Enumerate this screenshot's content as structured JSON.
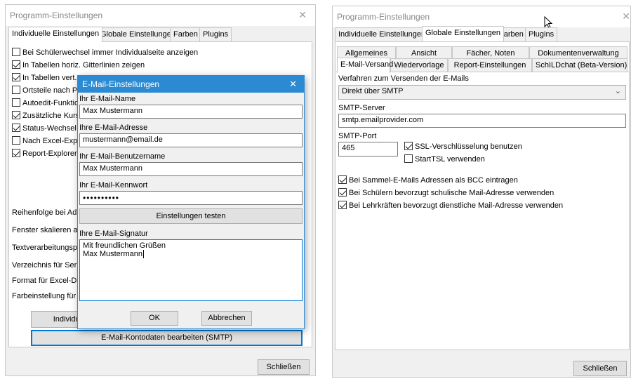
{
  "left_window": {
    "title": "Programm-Einstellungen",
    "close_glyph": "✕",
    "tabs": [
      "Individuelle Einstellungen",
      "Globale Einstellungen",
      "Farben",
      "Plugins"
    ],
    "checkboxes": [
      {
        "label": "Bei Schülerwechsel immer Individualseite anzeigen",
        "checked": false
      },
      {
        "label": "In Tabellen horiz. Gitterlinien zeigen",
        "checked": true
      },
      {
        "label": "In Tabellen vert.",
        "checked": true
      },
      {
        "label": "Ortsteile nach PLZ",
        "checked": false
      },
      {
        "label": "Autoedit-Funktion",
        "checked": false
      },
      {
        "label": "Zusätzliche Kursle",
        "checked": true
      },
      {
        "label": "Status-Wechsel o",
        "checked": true
      },
      {
        "label": "Nach Excel-Expor",
        "checked": false
      },
      {
        "label": "Report-Explorer a",
        "checked": true
      }
    ],
    "labels": [
      "Reihenfolge bei Adre",
      "Fenster skalieren au",
      "Textverarbeitungspr",
      "Verzeichnis für Serie",
      "Format für Excel-Dat",
      "Farbeinstellung für S"
    ],
    "individual_button": "Individuel",
    "smtp_button": "E-Mail-Kontodaten bearbeiten (SMTP)",
    "close_button": "Schließen"
  },
  "dialog": {
    "title": "E-Mail-Einstellungen",
    "close_glyph": "✕",
    "name_label": "Ihr E-Mail-Name",
    "name_value": "Max Mustermann",
    "address_label": "Ihre E-Mail-Adresse",
    "address_value": "mustermann@email.de",
    "username_label": "Ihr E-Mail-Benutzername",
    "username_value": "Max Mustermann",
    "password_label": "Ihr E-Mail-Kennwort",
    "password_value": "••••••••••",
    "test_button": "Einstellungen testen",
    "signature_label": "Ihre E-Mail-Signatur",
    "signature_line1": "Mit freundlichen Grüßen",
    "signature_line2": "Max Mustermann",
    "ok_button": "OK",
    "cancel_button": "Abbrechen"
  },
  "right_window": {
    "title": "Programm-Einstellungen",
    "close_glyph": "✕",
    "tabs": [
      "Individuelle Einstellungen",
      "Globale Einstellungen",
      "Farben",
      "Plugins"
    ],
    "subtabs_row1": [
      "Allgemeines",
      "Ansicht",
      "Fächer, Noten",
      "Dokumentenverwaltung"
    ],
    "subtabs_row2": [
      "E-Mail-Versand",
      "Wiedervorlage",
      "Report-Einstellungen",
      "SchILDchat (Beta-Version)"
    ],
    "method_label": "Verfahren zum Versenden der E-Mails",
    "method_value": "Direkt über SMTP",
    "server_label": "SMTP-Server",
    "server_value": "smtp.emailprovider.com",
    "port_label": "SMTP-Port",
    "port_value": "465",
    "ssl_label": "SSL-Verschlüsselung benutzen",
    "ssl_checked": true,
    "starttls_label": "StartTSL verwenden",
    "starttls_checked": false,
    "options": [
      {
        "label": "Bei Sammel-E-Mails Adressen als BCC eintragen",
        "checked": true
      },
      {
        "label": "Bei Schülern bevorzugt schulische Mail-Adresse verwenden",
        "checked": true
      },
      {
        "label": "Bei Lehrkräften bevorzugt dienstliche Mail-Adresse verwenden",
        "checked": true
      }
    ],
    "close_button": "Schließen"
  }
}
